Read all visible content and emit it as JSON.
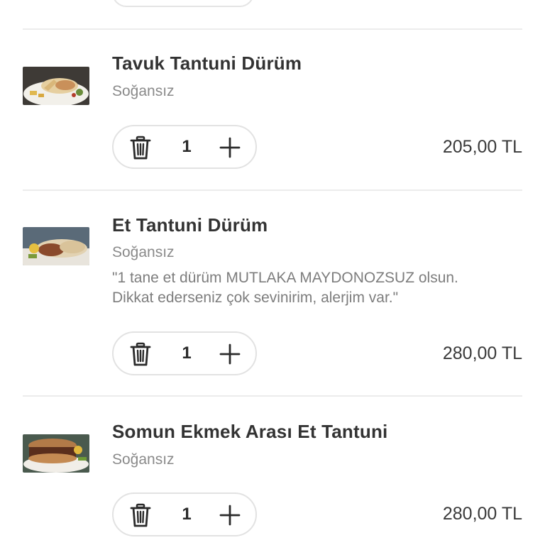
{
  "items": [
    {
      "name": "Tavuk Tantuni Dürüm",
      "option": "Soğansız",
      "quantity": "1",
      "price": "205,00 TL"
    },
    {
      "name": "Et Tantuni Dürüm",
      "option": "Soğansız",
      "note_line1": "\"1 tane et dürüm MUTLAKA MAYDONOZSUZ olsun.",
      "note_line2": "Dikkat ederseniz çok sevinirim, alerjim var.\"",
      "quantity": "1",
      "price": "280,00 TL"
    },
    {
      "name": "Somun Ekmek Arası Et Tantuni",
      "option": "Soğansız",
      "quantity": "1",
      "price": "280,00 TL"
    }
  ],
  "icons": {
    "delete": "trash-icon",
    "increase": "plus-icon"
  },
  "colors": {
    "text_primary": "#333333",
    "text_secondary": "#8a8a8a",
    "border": "#e2e2e2",
    "divider": "#ececec"
  }
}
